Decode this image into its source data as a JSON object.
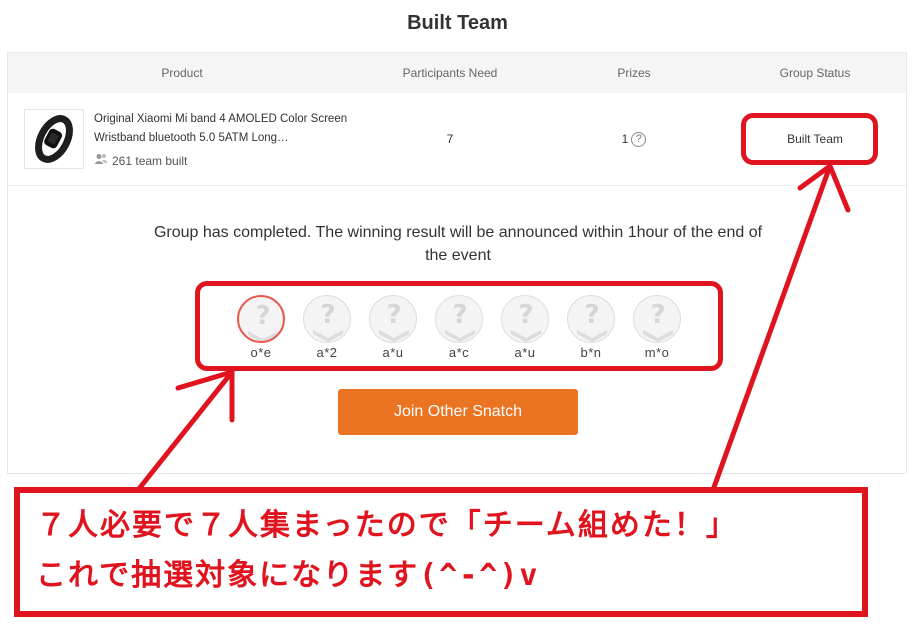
{
  "page": {
    "title": "Built Team"
  },
  "table": {
    "headers": {
      "product": "Product",
      "participants": "Participants Need",
      "prizes": "Prizes",
      "status": "Group Status"
    },
    "row": {
      "product_name": "Original Xiaomi Mi band 4 AMOLED Color Screen Wristband bluetooth 5.0 5ATM Long…",
      "team_built": "261 team built",
      "participants_need": "7",
      "prizes": "1",
      "prizes_help": "?",
      "status": "Built Team"
    }
  },
  "result": {
    "message": "Group has completed. The winning result will be announced within 1hour of the end of the event",
    "participants": [
      "o*e",
      "a*2",
      "a*u",
      "a*c",
      "a*u",
      "b*n",
      "m*o"
    ],
    "join_button": "Join Other Snatch"
  },
  "annotation": {
    "line1": "７人必要で７人集まったので「チーム組めた！」",
    "line2": "これで抽選対象になります(^-^)v",
    "color": "#e0141e"
  },
  "colors": {
    "accent": "#ea7422",
    "annotation": "#e0141e",
    "header_bg": "#f5f5f5"
  }
}
